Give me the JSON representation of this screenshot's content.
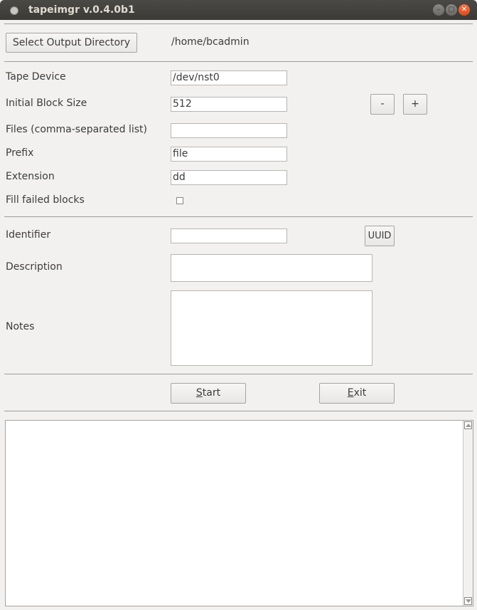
{
  "window": {
    "title": "tapeimgr v.0.4.0b1",
    "min_glyph": "–",
    "max_glyph": "□",
    "close_glyph": "✕"
  },
  "output": {
    "select_button": "Select Output Directory",
    "directory": "/home/bcadmin"
  },
  "fields": {
    "tape_device": {
      "label": "Tape Device",
      "value": "/dev/nst0"
    },
    "block_size": {
      "label": "Initial Block Size",
      "value": "512",
      "decrement": "-",
      "increment": "+"
    },
    "files": {
      "label": "Files (comma-separated list)",
      "value": ""
    },
    "prefix": {
      "label": "Prefix",
      "value": "file"
    },
    "extension": {
      "label": "Extension",
      "value": "dd"
    },
    "fill_failed": {
      "label": "Fill failed blocks",
      "checked": false
    }
  },
  "metadata": {
    "identifier": {
      "label": "Identifier",
      "value": ""
    },
    "uuid_button": "UUID",
    "description": {
      "label": "Description",
      "value": ""
    },
    "notes": {
      "label": "Notes",
      "value": ""
    }
  },
  "actions": {
    "start_first": "S",
    "start_rest": "tart",
    "exit_first": "E",
    "exit_rest": "xit"
  },
  "log": {
    "text": ""
  }
}
